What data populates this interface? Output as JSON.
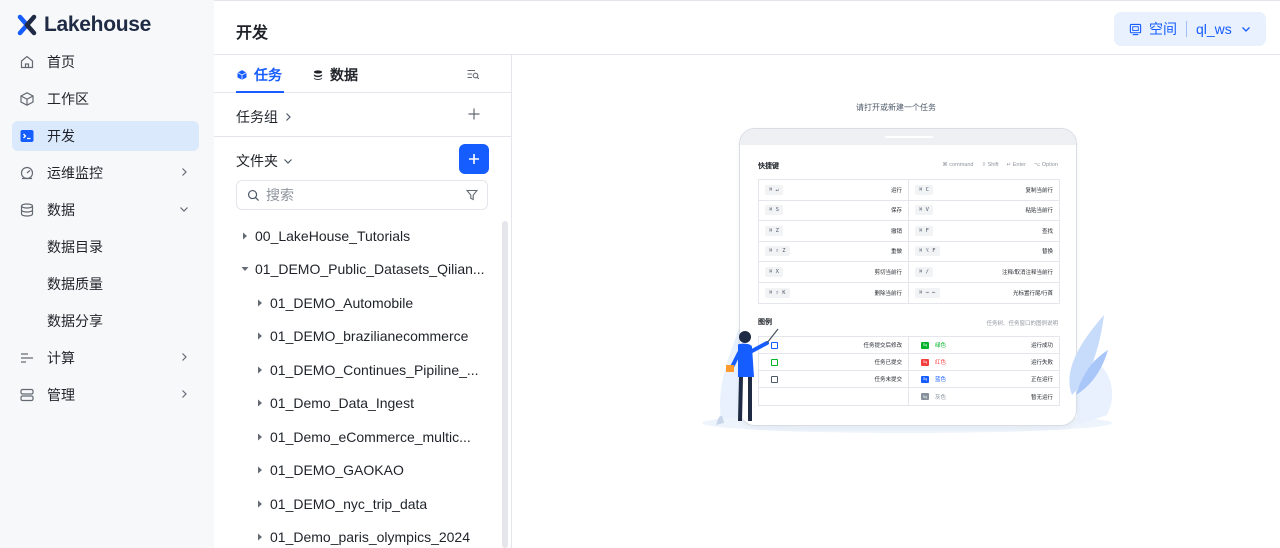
{
  "brand": {
    "name": "Lakehouse"
  },
  "sidebar": {
    "items": [
      {
        "label": "首页",
        "icon": "home-icon"
      },
      {
        "label": "工作区",
        "icon": "cube-icon"
      },
      {
        "label": "开发",
        "icon": "terminal-icon",
        "active": true
      },
      {
        "label": "运维监控",
        "icon": "monitor-icon",
        "expandable": true
      },
      {
        "label": "数据",
        "icon": "database-icon",
        "expanded": true
      },
      {
        "label": "数据目录"
      },
      {
        "label": "数据质量"
      },
      {
        "label": "数据分享"
      },
      {
        "label": "计算",
        "icon": "compute-icon",
        "expandable": true
      },
      {
        "label": "管理",
        "icon": "manage-icon",
        "expandable": true
      }
    ]
  },
  "header": {
    "title": "开发",
    "workspace_label": "空间",
    "workspace_name": "ql_ws"
  },
  "panel": {
    "tabs": [
      {
        "label": "任务",
        "icon": "cube-icon"
      },
      {
        "label": "数据",
        "icon": "database-icon"
      }
    ],
    "task_group_label": "任务组",
    "folder_label": "文件夹",
    "search_placeholder": "搜索",
    "tree": [
      {
        "label": "00_LakeHouse_Tutorials",
        "level": 0,
        "expanded": false
      },
      {
        "label": "01_DEMO_Public_Datasets_Qilian...",
        "level": 0,
        "expanded": true
      },
      {
        "label": "01_DEMO_Automobile",
        "level": 1,
        "expanded": false
      },
      {
        "label": "01_DEMO_brazilianecommerce",
        "level": 1,
        "expanded": false
      },
      {
        "label": "01_DEMO_Continues_Pipiline_...",
        "level": 1,
        "expanded": false
      },
      {
        "label": "01_Demo_Data_Ingest",
        "level": 1,
        "expanded": false
      },
      {
        "label": "01_Demo_eCommerce_multic...",
        "level": 1,
        "expanded": false
      },
      {
        "label": "01_DEMO_GAOKAO",
        "level": 1,
        "expanded": false
      },
      {
        "label": "01_DEMO_nyc_trip_data",
        "level": 1,
        "expanded": false
      },
      {
        "label": "01_Demo_paris_olympics_2024",
        "level": 1,
        "expanded": false
      }
    ]
  },
  "main": {
    "hint": "请打开或新建一个任务",
    "shortcuts": {
      "title": "快捷键",
      "legend": [
        "⌘ command",
        "⇧ Shift",
        "↵ Enter",
        "⌥ Option"
      ],
      "rows": [
        [
          {
            "key": "⌘ ↵",
            "desc": "运行"
          },
          {
            "key": "⌘ C",
            "desc": "复制当前行"
          }
        ],
        [
          {
            "key": "⌘ S",
            "desc": "保存"
          },
          {
            "key": "⌘ V",
            "desc": "粘贴当前行"
          }
        ],
        [
          {
            "key": "⌘ Z",
            "desc": "撤销"
          },
          {
            "key": "⌘ F",
            "desc": "查找"
          }
        ],
        [
          {
            "key": "⌘ ⇧ Z",
            "desc": "重做"
          },
          {
            "key": "⌘ ⌥ F",
            "desc": "替换"
          }
        ],
        [
          {
            "key": "⌘ X",
            "desc": "剪切当前行"
          },
          {
            "key": "⌘ /",
            "desc": "注释/取消注释当前行"
          }
        ],
        [
          {
            "key": "⌘ ⇧ K",
            "desc": "删除当前行"
          },
          {
            "key": "⌘ → ←",
            "desc": "光标置行尾/行首"
          }
        ]
      ]
    },
    "legend": {
      "title": "图例",
      "note": "任务树、任务窗口的图例说明",
      "left": [
        {
          "desc": "任务提交后修改"
        },
        {
          "desc": "任务已提交"
        },
        {
          "desc": "任务未提交"
        }
      ],
      "right": [
        {
          "badge": "Sq",
          "color_name": "绿色",
          "color": "#00b42a",
          "desc": "运行成功"
        },
        {
          "badge": "Sq",
          "color_name": "红色",
          "color": "#f53f3f",
          "desc": "运行失败"
        },
        {
          "badge": "Sq",
          "color_name": "蓝色",
          "color": "#165dff",
          "desc": "正在运行"
        },
        {
          "badge": "Sq",
          "color_name": "灰色",
          "color": "#86909c",
          "desc": "暂无运行"
        }
      ]
    }
  },
  "colors": {
    "accent": "#165dff",
    "sidebar_bg": "#f7f8fa",
    "active_bg": "#dbe9fd"
  }
}
